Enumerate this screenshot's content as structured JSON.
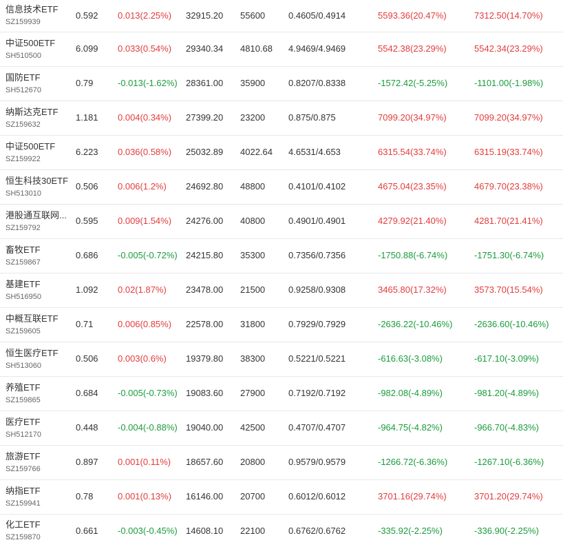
{
  "colors": {
    "rise": "#e33b3b",
    "fall": "#1a9b3c",
    "text": "#333333",
    "subtext": "#666666"
  },
  "rows": [
    {
      "name": "信息技术ETF",
      "code": "SZ159939",
      "price": "0.592",
      "change": "0.013(2.25%)",
      "change_dir": "up",
      "market_value": "32915.20",
      "shares": "55600",
      "cost": "0.4605/0.4914",
      "pl_a": "5593.36(20.47%)",
      "pl_a_dir": "up",
      "pl_b": "7312.50(14.70%)",
      "pl_b_dir": "up"
    },
    {
      "name": "中证500ETF",
      "code": "SH510500",
      "price": "6.099",
      "change": "0.033(0.54%)",
      "change_dir": "up",
      "market_value": "29340.34",
      "shares": "4810.68",
      "cost": "4.9469/4.9469",
      "pl_a": "5542.38(23.29%)",
      "pl_a_dir": "up",
      "pl_b": "5542.34(23.29%)",
      "pl_b_dir": "up"
    },
    {
      "name": "国防ETF",
      "code": "SH512670",
      "price": "0.79",
      "change": "-0.013(-1.62%)",
      "change_dir": "down",
      "market_value": "28361.00",
      "shares": "35900",
      "cost": "0.8207/0.8338",
      "pl_a": "-1572.42(-5.25%)",
      "pl_a_dir": "down",
      "pl_b": "-1101.00(-1.98%)",
      "pl_b_dir": "down"
    },
    {
      "name": "纳斯达克ETF",
      "code": "SZ159632",
      "price": "1.181",
      "change": "0.004(0.34%)",
      "change_dir": "up",
      "market_value": "27399.20",
      "shares": "23200",
      "cost": "0.875/0.875",
      "pl_a": "7099.20(34.97%)",
      "pl_a_dir": "up",
      "pl_b": "7099.20(34.97%)",
      "pl_b_dir": "up"
    },
    {
      "name": "中证500ETF",
      "code": "SZ159922",
      "price": "6.223",
      "change": "0.036(0.58%)",
      "change_dir": "up",
      "market_value": "25032.89",
      "shares": "4022.64",
      "cost": "4.6531/4.653",
      "pl_a": "6315.54(33.74%)",
      "pl_a_dir": "up",
      "pl_b": "6315.19(33.74%)",
      "pl_b_dir": "up"
    },
    {
      "name": "恒生科技30ETF",
      "code": "SH513010",
      "price": "0.506",
      "change": "0.006(1.2%)",
      "change_dir": "up",
      "market_value": "24692.80",
      "shares": "48800",
      "cost": "0.4101/0.4102",
      "pl_a": "4675.04(23.35%)",
      "pl_a_dir": "up",
      "pl_b": "4679.70(23.38%)",
      "pl_b_dir": "up"
    },
    {
      "name": "港股通互联网...",
      "code": "SZ159792",
      "price": "0.595",
      "change": "0.009(1.54%)",
      "change_dir": "up",
      "market_value": "24276.00",
      "shares": "40800",
      "cost": "0.4901/0.4901",
      "pl_a": "4279.92(21.40%)",
      "pl_a_dir": "up",
      "pl_b": "4281.70(21.41%)",
      "pl_b_dir": "up"
    },
    {
      "name": "畜牧ETF",
      "code": "SZ159867",
      "price": "0.686",
      "change": "-0.005(-0.72%)",
      "change_dir": "down",
      "market_value": "24215.80",
      "shares": "35300",
      "cost": "0.7356/0.7356",
      "pl_a": "-1750.88(-6.74%)",
      "pl_a_dir": "down",
      "pl_b": "-1751.30(-6.74%)",
      "pl_b_dir": "down"
    },
    {
      "name": "基建ETF",
      "code": "SH516950",
      "price": "1.092",
      "change": "0.02(1.87%)",
      "change_dir": "up",
      "market_value": "23478.00",
      "shares": "21500",
      "cost": "0.9258/0.9308",
      "pl_a": "3465.80(17.32%)",
      "pl_a_dir": "up",
      "pl_b": "3573.70(15.54%)",
      "pl_b_dir": "up"
    },
    {
      "name": "中概互联ETF",
      "code": "SZ159605",
      "price": "0.71",
      "change": "0.006(0.85%)",
      "change_dir": "up",
      "market_value": "22578.00",
      "shares": "31800",
      "cost": "0.7929/0.7929",
      "pl_a": "-2636.22(-10.46%)",
      "pl_a_dir": "down",
      "pl_b": "-2636.60(-10.46%)",
      "pl_b_dir": "down"
    },
    {
      "name": "恒生医疗ETF",
      "code": "SH513060",
      "price": "0.506",
      "change": "0.003(0.6%)",
      "change_dir": "up",
      "market_value": "19379.80",
      "shares": "38300",
      "cost": "0.5221/0.5221",
      "pl_a": "-616.63(-3.08%)",
      "pl_a_dir": "down",
      "pl_b": "-617.10(-3.09%)",
      "pl_b_dir": "down"
    },
    {
      "name": "养殖ETF",
      "code": "SZ159865",
      "price": "0.684",
      "change": "-0.005(-0.73%)",
      "change_dir": "down",
      "market_value": "19083.60",
      "shares": "27900",
      "cost": "0.7192/0.7192",
      "pl_a": "-982.08(-4.89%)",
      "pl_a_dir": "down",
      "pl_b": "-981.20(-4.89%)",
      "pl_b_dir": "down"
    },
    {
      "name": "医疗ETF",
      "code": "SH512170",
      "price": "0.448",
      "change": "-0.004(-0.88%)",
      "change_dir": "down",
      "market_value": "19040.00",
      "shares": "42500",
      "cost": "0.4707/0.4707",
      "pl_a": "-964.75(-4.82%)",
      "pl_a_dir": "down",
      "pl_b": "-966.70(-4.83%)",
      "pl_b_dir": "down"
    },
    {
      "name": "旅游ETF",
      "code": "SZ159766",
      "price": "0.897",
      "change": "0.001(0.11%)",
      "change_dir": "up",
      "market_value": "18657.60",
      "shares": "20800",
      "cost": "0.9579/0.9579",
      "pl_a": "-1266.72(-6.36%)",
      "pl_a_dir": "down",
      "pl_b": "-1267.10(-6.36%)",
      "pl_b_dir": "down"
    },
    {
      "name": "纳指ETF",
      "code": "SZ159941",
      "price": "0.78",
      "change": "0.001(0.13%)",
      "change_dir": "up",
      "market_value": "16146.00",
      "shares": "20700",
      "cost": "0.6012/0.6012",
      "pl_a": "3701.16(29.74%)",
      "pl_a_dir": "up",
      "pl_b": "3701.20(29.74%)",
      "pl_b_dir": "up"
    },
    {
      "name": "化工ETF",
      "code": "SZ159870",
      "price": "0.661",
      "change": "-0.003(-0.45%)",
      "change_dir": "down",
      "market_value": "14608.10",
      "shares": "22100",
      "cost": "0.6762/0.6762",
      "pl_a": "-335.92(-2.25%)",
      "pl_a_dir": "down",
      "pl_b": "-336.90(-2.25%)",
      "pl_b_dir": "down"
    }
  ]
}
